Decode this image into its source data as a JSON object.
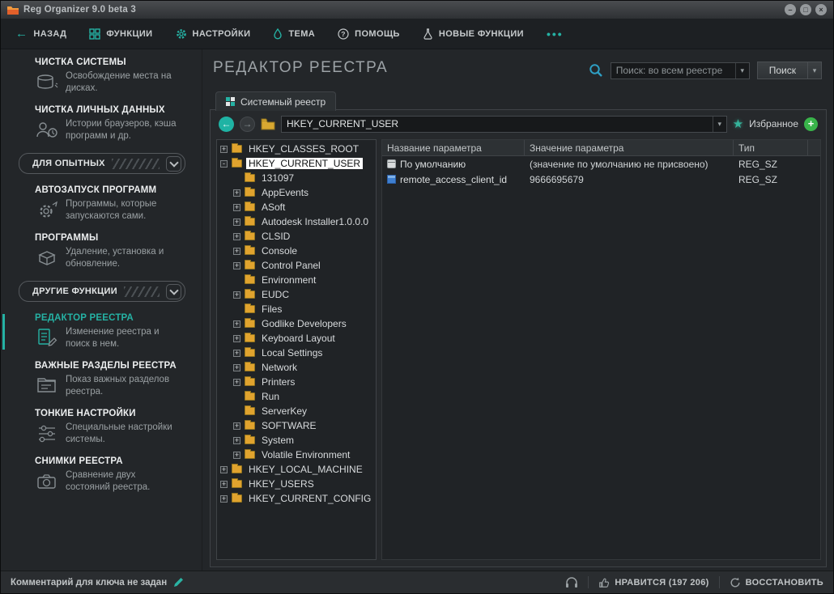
{
  "window": {
    "title": "Reg Organizer 9.0 beta 3"
  },
  "nav": {
    "back": "НАЗАД",
    "functions": "ФУНКЦИИ",
    "settings": "НАСТРОЙКИ",
    "theme": "ТЕМА",
    "help": "ПОМОЩЬ",
    "new_features": "НОВЫЕ ФУНКЦИИ"
  },
  "sidebar": {
    "items": [
      {
        "title": "ЧИСТКА СИСТЕМЫ",
        "desc": "Освобождение места на дисках."
      },
      {
        "title": "ЧИСТКА ЛИЧНЫХ ДАННЫХ",
        "desc": "Истории браузеров, кэша программ и др."
      },
      {
        "title": "АВТОЗАПУСК ПРОГРАММ",
        "desc": "Программы, которые запускаются сами."
      },
      {
        "title": "ПРОГРАММЫ",
        "desc": "Удаление, установка и обновление."
      },
      {
        "title": "РЕДАКТОР РЕЕСТРА",
        "desc": "Изменение реестра и поиск в нем."
      },
      {
        "title": "ВАЖНЫЕ РАЗДЕЛЫ РЕЕСТРА",
        "desc": "Показ важных разделов реестра."
      },
      {
        "title": "ТОНКИЕ НАСТРОЙКИ",
        "desc": "Специальные настройки системы."
      },
      {
        "title": "СНИМКИ РЕЕСТРА",
        "desc": "Сравнение двух состояний реестра."
      }
    ],
    "groups": [
      {
        "label": "ДЛЯ ОПЫТНЫХ"
      },
      {
        "label": "ДРУГИЕ ФУНКЦИИ"
      }
    ]
  },
  "main": {
    "title": "РЕДАКТОР РЕЕСТРА",
    "search": {
      "placeholder": "Поиск: во всем реестре",
      "button": "Поиск"
    },
    "tab": "Системный реестр",
    "address": "HKEY_CURRENT_USER",
    "favorites": "Избранное"
  },
  "tree": {
    "items": [
      {
        "label": "HKEY_CLASSES_ROOT",
        "level": 0,
        "expand": "plus"
      },
      {
        "label": "HKEY_CURRENT_USER",
        "level": 0,
        "expand": "minus",
        "selected": true
      },
      {
        "label": "131097",
        "level": 1,
        "expand": "none"
      },
      {
        "label": "AppEvents",
        "level": 1,
        "expand": "plus"
      },
      {
        "label": "ASoft",
        "level": 1,
        "expand": "plus"
      },
      {
        "label": "Autodesk Installer1.0.0.0",
        "level": 1,
        "expand": "plus"
      },
      {
        "label": "CLSID",
        "level": 1,
        "expand": "plus"
      },
      {
        "label": "Console",
        "level": 1,
        "expand": "plus"
      },
      {
        "label": "Control Panel",
        "level": 1,
        "expand": "plus"
      },
      {
        "label": "Environment",
        "level": 1,
        "expand": "none"
      },
      {
        "label": "EUDC",
        "level": 1,
        "expand": "plus"
      },
      {
        "label": "Files",
        "level": 1,
        "expand": "none"
      },
      {
        "label": "Godlike Developers",
        "level": 1,
        "expand": "plus"
      },
      {
        "label": "Keyboard Layout",
        "level": 1,
        "expand": "plus"
      },
      {
        "label": "Local Settings",
        "level": 1,
        "expand": "plus"
      },
      {
        "label": "Network",
        "level": 1,
        "expand": "plus"
      },
      {
        "label": "Printers",
        "level": 1,
        "expand": "plus"
      },
      {
        "label": "Run",
        "level": 1,
        "expand": "none"
      },
      {
        "label": "ServerKey",
        "level": 1,
        "expand": "none"
      },
      {
        "label": "SOFTWARE",
        "level": 1,
        "expand": "plus"
      },
      {
        "label": "System",
        "level": 1,
        "expand": "plus"
      },
      {
        "label": "Volatile Environment",
        "level": 1,
        "expand": "plus"
      },
      {
        "label": "HKEY_LOCAL_MACHINE",
        "level": 0,
        "expand": "plus"
      },
      {
        "label": "HKEY_USERS",
        "level": 0,
        "expand": "plus"
      },
      {
        "label": "HKEY_CURRENT_CONFIG",
        "level": 0,
        "expand": "plus"
      }
    ]
  },
  "table": {
    "columns": [
      "Название параметра",
      "Значение параметра",
      "Тип"
    ],
    "rows": [
      {
        "name": "По умолчанию",
        "value": "(значение по умолчанию не присвоено)",
        "type": "REG_SZ"
      },
      {
        "name": "remote_access_client_id",
        "value": "9666695679",
        "type": "REG_SZ"
      }
    ]
  },
  "statusbar": {
    "comment": "Комментарий для ключа не задан",
    "likes": "НРАВИТСЯ (197 206)",
    "restore": "ВОССТАНОВИТЬ"
  }
}
